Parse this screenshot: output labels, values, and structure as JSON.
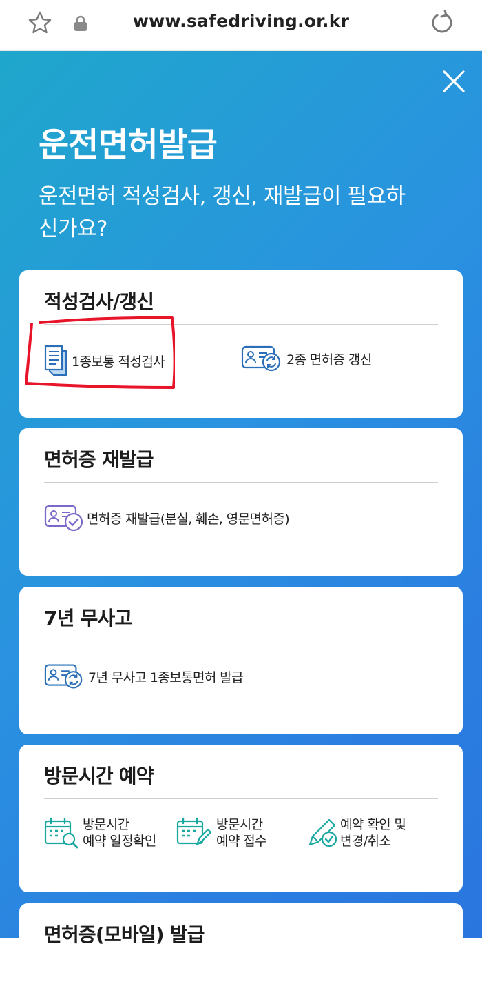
{
  "browser": {
    "url": "www.safedriving.or.kr",
    "star_icon": "star-icon",
    "lock_icon": "lock-icon",
    "reload_icon": "reload-icon"
  },
  "header": {
    "title": "운전면허발급",
    "subtitle": "운전면허 적성검사, 갱신, 재발급이 필요하신가요?",
    "close_icon": "close-icon"
  },
  "sections": {
    "aptitude": {
      "title": "적성검사/갱신",
      "items": [
        {
          "label": "1종보통 적성검사",
          "icon": "document-icon"
        },
        {
          "label": "2종 면허증 갱신",
          "icon": "license-renew-icon"
        }
      ]
    },
    "reissue": {
      "title": "면허증 재발급",
      "items": [
        {
          "label": "면허증 재발급(분실, 훼손, 영문면허증)",
          "icon": "license-check-icon"
        }
      ]
    },
    "seven_year": {
      "title": "7년 무사고",
      "items": [
        {
          "label": "7년 무사고 1종보통면허 발급",
          "icon": "license-renew-icon"
        }
      ]
    },
    "reservation": {
      "title": "방문시간 예약",
      "items": [
        {
          "line1": "방문시간",
          "line2": "예약 일정확인",
          "icon": "calendar-search-icon"
        },
        {
          "line1": "방문시간",
          "line2": "예약 접수",
          "icon": "calendar-edit-icon"
        },
        {
          "line1": "예약 확인 및",
          "line2": "변경/취소",
          "icon": "pen-check-icon"
        }
      ]
    },
    "mobile": {
      "title": "면허증(모바일) 발급"
    }
  },
  "colors": {
    "gradient_start": "#1fa7cc",
    "gradient_end": "#2a76df",
    "icon_blue": "#2a6fb8",
    "icon_teal": "#19a8a0",
    "icon_purple": "#7b68c8",
    "highlight_red": "#e8152a"
  }
}
